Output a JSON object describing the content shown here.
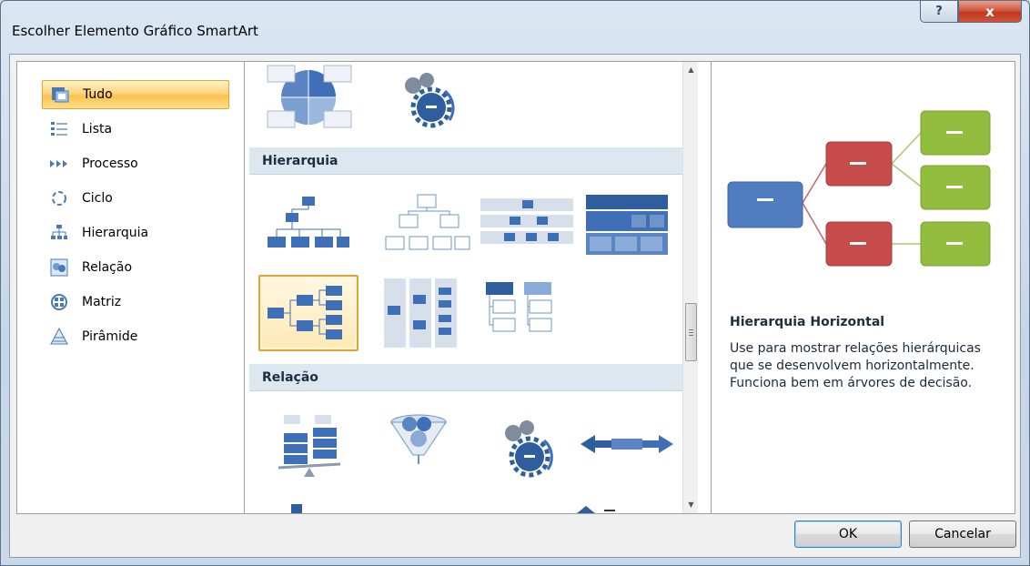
{
  "dialog": {
    "title": "Escolher Elemento Gráfico SmartArt",
    "help_glyph": "?",
    "close_glyph": "x"
  },
  "categories": [
    {
      "label": "Tudo",
      "icon": "all-icon",
      "selected": true
    },
    {
      "label": "Lista",
      "icon": "list-icon"
    },
    {
      "label": "Processo",
      "icon": "process-icon"
    },
    {
      "label": "Ciclo",
      "icon": "cycle-icon"
    },
    {
      "label": "Hierarquia",
      "icon": "hierarchy-icon"
    },
    {
      "label": "Relação",
      "icon": "relationship-icon"
    },
    {
      "label": "Matriz",
      "icon": "matrix-icon"
    },
    {
      "label": "Pirâmide",
      "icon": "pyramid-icon"
    }
  ],
  "gallery": {
    "sections": [
      {
        "title": "Hierarquia"
      },
      {
        "title": "Relação"
      }
    ],
    "selected_layout": "Hierarquia Horizontal"
  },
  "preview": {
    "title": "Hierarquia Horizontal",
    "description": "Use para mostrar relações hierárquicas que se desenvolvem horizontalmente. Funciona bem em árvores de decisão.",
    "placeholder_glyph": "—"
  },
  "buttons": {
    "ok": "OK",
    "cancel": "Cancelar"
  },
  "colors": {
    "blue": "#3f6fb6",
    "red": "#c64b4b",
    "green": "#93bd3e",
    "selection_orange": "#fbc24c"
  }
}
